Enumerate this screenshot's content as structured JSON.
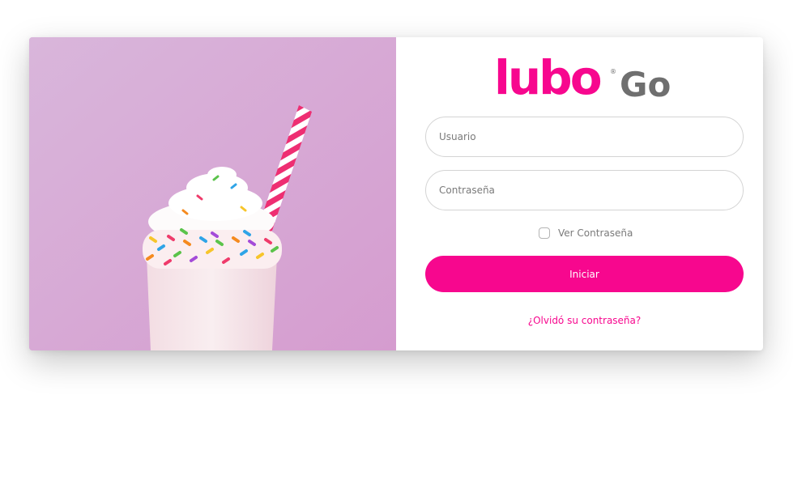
{
  "theme": {
    "brand": "#f7078e",
    "gray": "#6f6f6f"
  },
  "logo": {
    "word": "lubo",
    "registered": "®",
    "suffix": "Go"
  },
  "form": {
    "username_placeholder": "Usuario",
    "password_placeholder": "Contraseña",
    "show_password_label": "Ver Contraseña",
    "show_password_checked": false,
    "submit_label": "Iniciar",
    "forgot_link": "¿Olvidó su contraseña?"
  }
}
